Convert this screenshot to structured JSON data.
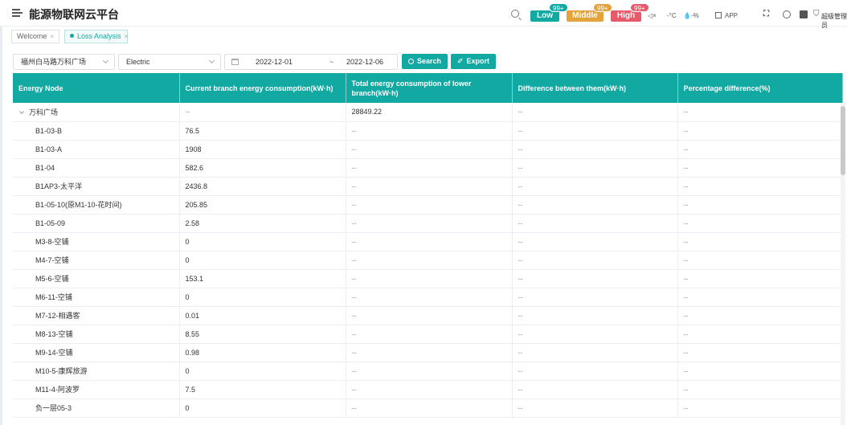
{
  "header": {
    "title": "能源物联网云平台",
    "alarm_levels": [
      {
        "label": "Low",
        "badge": "99+",
        "color": "#12a9a3"
      },
      {
        "label": "Middle",
        "badge": "99+",
        "color": "#e3a33a"
      },
      {
        "label": "High",
        "badge": "99+",
        "color": "#e8596a"
      }
    ],
    "status": {
      "speaker": "◁×",
      "temperature": "-°C",
      "humidity": "-%",
      "app_label": "APP",
      "user": "超级管理员"
    }
  },
  "tabs": [
    {
      "label": "Welcome",
      "active": false
    },
    {
      "label": "Loss Analysis",
      "active": true
    }
  ],
  "filters": {
    "site": "福州白马路万科广场",
    "energy_type": "Electric",
    "date_start": "2022-12-01",
    "date_sep": "~",
    "date_end": "2022-12-06",
    "search_label": "Search",
    "export_label": "Export"
  },
  "table": {
    "columns": [
      "Energy Node",
      "Current branch energy consumption(kW·h)",
      "Total energy consumption of lower branch(kW·h)",
      "Difference between them(kW·h)",
      "Percentage difference(%)"
    ],
    "rows": [
      {
        "node": "万科广场",
        "current": "--",
        "lower": "28849.22",
        "diff": "--",
        "pct": "--"
      },
      {
        "node": "B1-03-B",
        "current": "76.5",
        "lower": "--",
        "diff": "--",
        "pct": "--"
      },
      {
        "node": "B1-03-A",
        "current": "1908",
        "lower": "--",
        "diff": "--",
        "pct": "--"
      },
      {
        "node": "B1-04",
        "current": "582.6",
        "lower": "--",
        "diff": "--",
        "pct": "--"
      },
      {
        "node": "B1AP3-太平洋",
        "current": "2436.8",
        "lower": "--",
        "diff": "--",
        "pct": "--"
      },
      {
        "node": "B1-05-10(原M1-10-花时间)",
        "current": "205.85",
        "lower": "--",
        "diff": "--",
        "pct": "--"
      },
      {
        "node": "B1-05-09",
        "current": "2.58",
        "lower": "--",
        "diff": "--",
        "pct": "--"
      },
      {
        "node": "M3-8-空铺",
        "current": "0",
        "lower": "--",
        "diff": "--",
        "pct": "--"
      },
      {
        "node": "M4-7-空铺",
        "current": "0",
        "lower": "--",
        "diff": "--",
        "pct": "--"
      },
      {
        "node": "M5-6-空铺",
        "current": "153.1",
        "lower": "--",
        "diff": "--",
        "pct": "--"
      },
      {
        "node": "M6-11-空铺",
        "current": "0",
        "lower": "--",
        "diff": "--",
        "pct": "--"
      },
      {
        "node": "M7-12-相遇客",
        "current": "0.01",
        "lower": "--",
        "diff": "--",
        "pct": "--"
      },
      {
        "node": "M8-13-空铺",
        "current": "8.55",
        "lower": "--",
        "diff": "--",
        "pct": "--"
      },
      {
        "node": "M9-14-空铺",
        "current": "0.98",
        "lower": "--",
        "diff": "--",
        "pct": "--"
      },
      {
        "node": "M10-5-康辉旅游",
        "current": "0",
        "lower": "--",
        "diff": "--",
        "pct": "--"
      },
      {
        "node": "M11-4-阿波罗",
        "current": "7.5",
        "lower": "--",
        "diff": "--",
        "pct": "--"
      },
      {
        "node": "负一层05-3",
        "current": "0",
        "lower": "--",
        "diff": "--",
        "pct": "--"
      }
    ]
  }
}
